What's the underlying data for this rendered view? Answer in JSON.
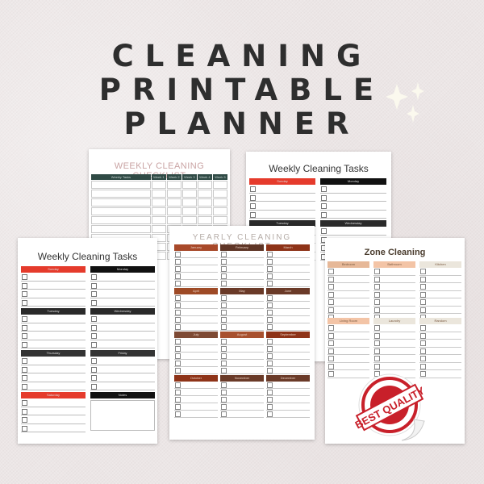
{
  "header": {
    "line1": "CLEANING",
    "line2": "PRINTABLE",
    "line3": "PLANNER",
    "sparkle_icon": "sparkles-icon"
  },
  "weekly_checklist": {
    "title": "WEEKLY CLEANING CHECKLIST",
    "columns": [
      "Weekly Tasks",
      "Week 1",
      "Week 2",
      "Week 3",
      "Week 4",
      "Week 5"
    ],
    "row_count": 9,
    "header_color": "#2f4a45"
  },
  "weekly_tasks_back": {
    "title": "Weekly Cleaning Tasks",
    "days": [
      {
        "label": "Sunday",
        "color": "#e53b2c"
      },
      {
        "label": "Monday",
        "color": "#111111"
      },
      {
        "label": "Tuesday",
        "color": "#2a2a2a"
      },
      {
        "label": "Wednesday",
        "color": "#2a2a2a"
      }
    ]
  },
  "weekly_tasks_front": {
    "title": "Weekly Cleaning Tasks",
    "days": [
      {
        "label": "Sunday",
        "color": "#e53b2c"
      },
      {
        "label": "Monday",
        "color": "#111111"
      },
      {
        "label": "Tuesday",
        "color": "#2a2a2a"
      },
      {
        "label": "Wednesday",
        "color": "#2a2a2a"
      },
      {
        "label": "Thursday",
        "color": "#333333"
      },
      {
        "label": "Friday",
        "color": "#333333"
      },
      {
        "label": "Saturday",
        "color": "#e53b2c"
      },
      {
        "label": "Notes",
        "color": "#111111"
      }
    ]
  },
  "yearly_checklist": {
    "title": "YEARLY CLEANING CHECKLIST",
    "months": [
      {
        "label": "January",
        "color": "#a8492a"
      },
      {
        "label": "February",
        "color": "#5e3526"
      },
      {
        "label": "March",
        "color": "#8e3318"
      },
      {
        "label": "April",
        "color": "#9e4a26"
      },
      {
        "label": "May",
        "color": "#6a3a28"
      },
      {
        "label": "June",
        "color": "#6a3a28"
      },
      {
        "label": "July",
        "color": "#7e4a34"
      },
      {
        "label": "August",
        "color": "#a8512f"
      },
      {
        "label": "September",
        "color": "#8e3318"
      },
      {
        "label": "October",
        "color": "#8e3318"
      },
      {
        "label": "November",
        "color": "#6a3a28"
      },
      {
        "label": "December",
        "color": "#6a3a28"
      }
    ]
  },
  "zone_cleaning": {
    "title": "Zone Cleaning",
    "zones": [
      {
        "label": "Bedroom",
        "color": "#e6b898"
      },
      {
        "label": "Bathroom",
        "color": "#f3c4a6"
      },
      {
        "label": "Kitchen",
        "color": "#ebe6dc"
      },
      {
        "label": "Living Room",
        "color": "#f3c4a6"
      },
      {
        "label": "Laundry",
        "color": "#ebe6dc"
      },
      {
        "label": "Random",
        "color": "#ebe6dc"
      }
    ]
  },
  "badge": {
    "text": "BEST QUALITY",
    "color": "#c8202a"
  }
}
